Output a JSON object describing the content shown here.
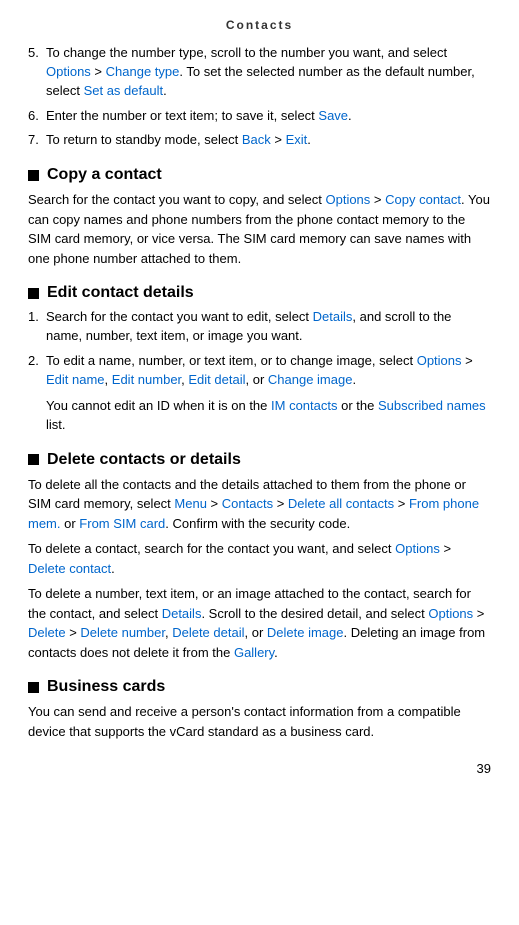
{
  "header": {
    "title": "Contacts"
  },
  "page_number": "39",
  "items_top": [
    {
      "num": "5.",
      "text_parts": [
        {
          "type": "plain",
          "text": "To change the number type, scroll to the number you want, and select "
        },
        {
          "type": "link",
          "text": "Options"
        },
        {
          "type": "plain",
          "text": " > "
        },
        {
          "type": "link",
          "text": "Change type"
        },
        {
          "type": "plain",
          "text": ". To set the selected number as the default number, select "
        },
        {
          "type": "link",
          "text": "Set as default"
        },
        {
          "type": "plain",
          "text": "."
        }
      ]
    },
    {
      "num": "6.",
      "text_parts": [
        {
          "type": "plain",
          "text": "Enter the number or text item; to save it, select "
        },
        {
          "type": "link",
          "text": "Save"
        },
        {
          "type": "plain",
          "text": "."
        }
      ]
    },
    {
      "num": "7.",
      "text_parts": [
        {
          "type": "plain",
          "text": "To return to standby mode, select "
        },
        {
          "type": "link",
          "text": "Back"
        },
        {
          "type": "plain",
          "text": " > "
        },
        {
          "type": "link",
          "text": "Exit"
        },
        {
          "type": "plain",
          "text": "."
        }
      ]
    }
  ],
  "sections": [
    {
      "id": "copy-contact",
      "heading": "Copy a contact",
      "body": [
        {
          "type": "paragraph",
          "parts": [
            {
              "type": "plain",
              "text": "Search for the contact you want to copy, and select "
            },
            {
              "type": "link",
              "text": "Options"
            },
            {
              "type": "plain",
              "text": " > "
            },
            {
              "type": "link",
              "text": "Copy contact"
            },
            {
              "type": "plain",
              "text": ". You can copy names and phone numbers from the phone contact memory to the SIM card memory, or vice versa. The SIM card memory can save names with one phone number attached to them."
            }
          ]
        }
      ]
    },
    {
      "id": "edit-contact-details",
      "heading": "Edit contact details",
      "body": [
        {
          "type": "numbered",
          "items": [
            {
              "num": "1.",
              "parts": [
                {
                  "type": "plain",
                  "text": "Search for the contact you want to edit, select "
                },
                {
                  "type": "link",
                  "text": "Details"
                },
                {
                  "type": "plain",
                  "text": ", and scroll to the name, number, text item, or image you want."
                }
              ]
            },
            {
              "num": "2.",
              "parts": [
                {
                  "type": "plain",
                  "text": "To edit a name, number, or text item, or to change image, select "
                },
                {
                  "type": "link",
                  "text": "Options"
                },
                {
                  "type": "plain",
                  "text": " > "
                },
                {
                  "type": "link",
                  "text": "Edit name"
                },
                {
                  "type": "plain",
                  "text": ", "
                },
                {
                  "type": "link",
                  "text": "Edit number"
                },
                {
                  "type": "plain",
                  "text": ", "
                },
                {
                  "type": "link",
                  "text": "Edit detail"
                },
                {
                  "type": "plain",
                  "text": ", or "
                },
                {
                  "type": "link",
                  "text": "Change image"
                },
                {
                  "type": "plain",
                  "text": "."
                }
              ]
            }
          ]
        },
        {
          "type": "indented",
          "parts": [
            {
              "type": "plain",
              "text": "You cannot edit an ID when it is on the "
            },
            {
              "type": "link",
              "text": "IM contacts"
            },
            {
              "type": "plain",
              "text": " or the "
            },
            {
              "type": "link",
              "text": "Subscribed names"
            },
            {
              "type": "plain",
              "text": " list."
            }
          ]
        }
      ]
    },
    {
      "id": "delete-contacts",
      "heading": "Delete contacts or details",
      "body": [
        {
          "type": "paragraph",
          "parts": [
            {
              "type": "plain",
              "text": "To delete all the contacts and the details attached to them from the phone or SIM card memory, select "
            },
            {
              "type": "link",
              "text": "Menu"
            },
            {
              "type": "plain",
              "text": " > "
            },
            {
              "type": "link",
              "text": "Contacts"
            },
            {
              "type": "plain",
              "text": " > "
            },
            {
              "type": "link",
              "text": "Delete all contacts"
            },
            {
              "type": "plain",
              "text": " > "
            },
            {
              "type": "link",
              "text": "From phone mem."
            },
            {
              "type": "plain",
              "text": " or "
            },
            {
              "type": "link",
              "text": "From SIM card"
            },
            {
              "type": "plain",
              "text": ". Confirm with the security code."
            }
          ]
        },
        {
          "type": "paragraph",
          "parts": [
            {
              "type": "plain",
              "text": "To delete a contact, search for the contact you want, and select "
            },
            {
              "type": "link",
              "text": "Options"
            },
            {
              "type": "plain",
              "text": " > "
            },
            {
              "type": "link",
              "text": "Delete contact"
            },
            {
              "type": "plain",
              "text": "."
            }
          ]
        },
        {
          "type": "paragraph",
          "parts": [
            {
              "type": "plain",
              "text": "To delete a number, text item, or an image attached to the contact, search for the contact, and select "
            },
            {
              "type": "link",
              "text": "Details"
            },
            {
              "type": "plain",
              "text": ". Scroll to the desired detail, and select "
            },
            {
              "type": "link",
              "text": "Options"
            },
            {
              "type": "plain",
              "text": " > "
            },
            {
              "type": "link",
              "text": "Delete"
            },
            {
              "type": "plain",
              "text": " > "
            },
            {
              "type": "link",
              "text": "Delete number"
            },
            {
              "type": "plain",
              "text": ", "
            },
            {
              "type": "link",
              "text": "Delete detail"
            },
            {
              "type": "plain",
              "text": ", or "
            },
            {
              "type": "link",
              "text": "Delete image"
            },
            {
              "type": "plain",
              "text": ". Deleting an image from contacts does not delete it from the "
            },
            {
              "type": "link",
              "text": "Gallery"
            },
            {
              "type": "plain",
              "text": "."
            }
          ]
        }
      ]
    },
    {
      "id": "business-cards",
      "heading": "Business cards",
      "body": [
        {
          "type": "paragraph",
          "parts": [
            {
              "type": "plain",
              "text": "You can send and receive a person's contact information from a compatible device that supports the vCard standard as a business card."
            }
          ]
        }
      ]
    }
  ]
}
